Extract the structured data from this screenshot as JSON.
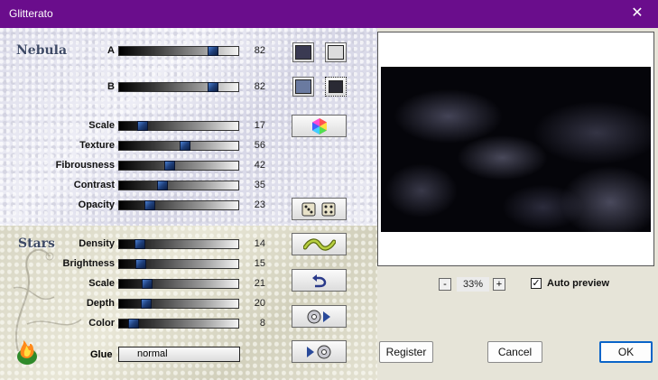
{
  "window": {
    "title": "Glitterato",
    "close_glyph": "✕"
  },
  "nebula": {
    "title": "Nebula",
    "rows": [
      {
        "label": "A",
        "value": "82",
        "pos": 0.82
      },
      {
        "label": "B",
        "value": "82",
        "pos": 0.82
      },
      {
        "label": "Scale",
        "value": "17",
        "pos": 0.17
      },
      {
        "label": "Texture",
        "value": "56",
        "pos": 0.56
      },
      {
        "label": "Fibrousness",
        "value": "42",
        "pos": 0.42
      },
      {
        "label": "Contrast",
        "value": "35",
        "pos": 0.35
      },
      {
        "label": "Opacity",
        "value": "23",
        "pos": 0.23
      }
    ]
  },
  "stars": {
    "title": "Stars",
    "rows": [
      {
        "label": "Density",
        "value": "14",
        "pos": 0.14
      },
      {
        "label": "Brightness",
        "value": "15",
        "pos": 0.15
      },
      {
        "label": "Scale",
        "value": "21",
        "pos": 0.21
      },
      {
        "label": "Depth",
        "value": "20",
        "pos": 0.2
      },
      {
        "label": "Color",
        "value": "8",
        "pos": 0.08
      }
    ]
  },
  "swatches": {
    "a_left": "#3a3a52",
    "a_right": "#dcdcdc",
    "b_left": "#6a7aa0",
    "b_right": "#2a2a34"
  },
  "glue": {
    "label": "Glue",
    "value": "normal"
  },
  "preview": {
    "zoom": "33%",
    "minus": "-",
    "plus": "+",
    "auto_preview_label": "Auto preview",
    "auto_preview_mark": "✓"
  },
  "buttons": {
    "register": "Register",
    "cancel": "Cancel",
    "ok": "OK"
  },
  "icons": {
    "hexagon": "hexagon-color-icon",
    "dice": "dice-icon",
    "wave": "wave-icon",
    "undo": "undo-arrow-icon",
    "disk_out": "disk-arrow-right-icon",
    "disk_in": "arrow-disk-icon",
    "logo": "flame-logo-icon"
  }
}
